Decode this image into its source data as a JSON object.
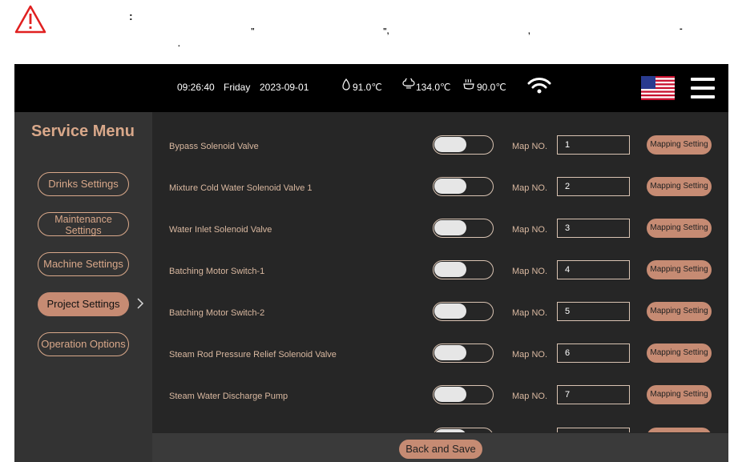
{
  "warning": {
    "icon": "warning-triangle-icon",
    "colors": {
      "warning": "#e02020"
    },
    "fragments": [
      ":",
      "\"",
      "\",",
      ",",
      "-",
      "."
    ]
  },
  "statusbar": {
    "time": "09:26:40",
    "day": "Friday",
    "date": "2023-09-01",
    "temp1": "91.0℃",
    "temp2": "134.0℃",
    "temp3": "90.0℃"
  },
  "sidebar": {
    "title": "Service Menu",
    "items": [
      {
        "label": "Drinks Settings",
        "active": false
      },
      {
        "label": "Maintenance Settings",
        "active": false
      },
      {
        "label": "Machine Settings",
        "active": false
      },
      {
        "label": "Project Settings",
        "active": true
      },
      {
        "label": "Operation Options",
        "active": false
      }
    ]
  },
  "rows": [
    {
      "label": "Bypass Solenoid Valve",
      "map_label": "Map NO.",
      "map_value": "1",
      "button": "Mapping Setting"
    },
    {
      "label": "Mixture Cold Water Solenoid Valve 1",
      "map_label": "Map NO.",
      "map_value": "2",
      "button": "Mapping Setting"
    },
    {
      "label": "Water Inlet Solenoid Valve",
      "map_label": "Map NO.",
      "map_value": "3",
      "button": "Mapping Setting"
    },
    {
      "label": "Batching Motor Switch-1",
      "map_label": "Map NO.",
      "map_value": "4",
      "button": "Mapping Setting"
    },
    {
      "label": "Batching Motor Switch-2",
      "map_label": "Map NO.",
      "map_value": "5",
      "button": "Mapping Setting"
    },
    {
      "label": "Steam Rod Pressure Relief Solenoid Valve",
      "map_label": "Map NO.",
      "map_value": "6",
      "button": "Mapping Setting"
    },
    {
      "label": "Steam Water Discharge Pump",
      "map_label": "Map NO.",
      "map_value": "7",
      "button": "Mapping Setting"
    }
  ],
  "footer": {
    "back_save": "Back and Save"
  },
  "colors": {
    "accent": "#c68b73",
    "text_accent": "#d9a88a",
    "panel": "#262626",
    "sidebar": "#333333",
    "statusbar": "#000000"
  }
}
